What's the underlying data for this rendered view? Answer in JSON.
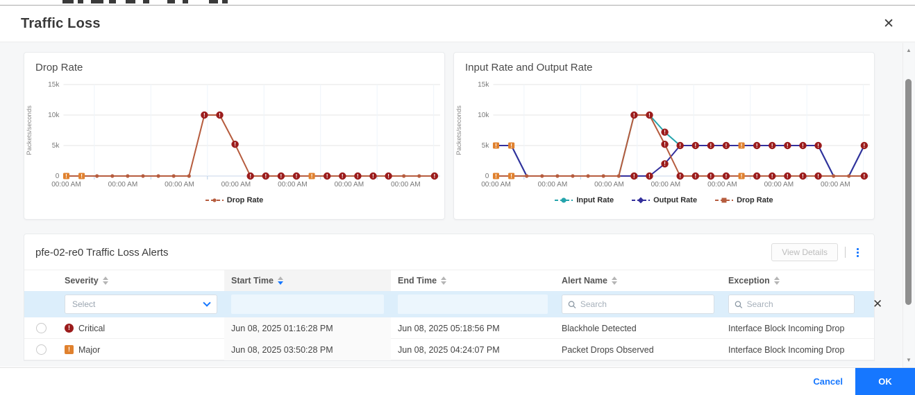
{
  "modal": {
    "title": "Traffic Loss",
    "close_icon": "✕"
  },
  "footer": {
    "cancel_label": "Cancel",
    "ok_label": "OK"
  },
  "colors": {
    "accent": "#1677ff",
    "critical": "#9b1c1c",
    "major": "#e0812e",
    "input_rate": "#25a4ac",
    "output_rate": "#332f9c",
    "drop_rate": "#b65c3e"
  },
  "chart_data": [
    {
      "type": "line",
      "title": "Drop Rate",
      "ylabel": "Packets/seconds",
      "ylim": [
        0,
        15000
      ],
      "yticks": [
        0,
        5000,
        10000,
        15000
      ],
      "ytick_labels": [
        "0",
        "5k",
        "10k",
        "15k"
      ],
      "xtick_labels": [
        "00:00 AM",
        "00:00 AM",
        "00:00 AM",
        "00:00 AM",
        "00:00 AM",
        "00:00 AM",
        "00:00 AM"
      ],
      "grid": true,
      "legend_position": "bottom",
      "series": [
        {
          "name": "Drop Rate",
          "color": "#b65c3e",
          "values": [
            0,
            0,
            0,
            0,
            0,
            0,
            0,
            0,
            0,
            10000,
            10000,
            5200,
            0,
            0,
            0,
            0,
            0,
            0,
            0,
            0,
            0,
            0,
            0,
            0,
            0
          ],
          "markers": [
            "major",
            "major",
            "dot",
            "dot",
            "dot",
            "dot",
            "dot",
            "dot",
            "dot",
            "critical",
            "critical",
            "critical",
            "critical",
            "critical",
            "critical",
            "critical",
            "major",
            "critical",
            "critical",
            "critical",
            "critical",
            "critical",
            "dot",
            "dot",
            "critical"
          ]
        }
      ],
      "legend": [
        {
          "label": "Drop Rate",
          "color": "#b65c3e",
          "marker": "dot"
        }
      ]
    },
    {
      "type": "line",
      "title": "Input Rate and Output Rate",
      "ylabel": "Packets/seconds",
      "ylim": [
        0,
        15000
      ],
      "yticks": [
        0,
        5000,
        10000,
        15000
      ],
      "ytick_labels": [
        "0",
        "5k",
        "10k",
        "15k"
      ],
      "xtick_labels": [
        "00:00 AM",
        "00:00 AM",
        "00:00 AM",
        "00:00 AM",
        "00:00 AM",
        "00:00 AM",
        "00:00 AM"
      ],
      "grid": true,
      "legend_position": "bottom",
      "series": [
        {
          "name": "Input Rate",
          "color": "#25a4ac",
          "values": [
            5000,
            5000,
            0,
            0,
            0,
            0,
            0,
            0,
            0,
            10000,
            10000,
            7200,
            5000,
            5000,
            5000,
            5000,
            5000,
            5000,
            5000,
            5000,
            5000,
            5000,
            0,
            0,
            5000
          ],
          "markers": [
            "none",
            "none",
            "none",
            "none",
            "none",
            "none",
            "none",
            "none",
            "none",
            "none",
            "none",
            "critical",
            "none",
            "none",
            "none",
            "none",
            "none",
            "none",
            "none",
            "none",
            "none",
            "none",
            "none",
            "none",
            "none"
          ]
        },
        {
          "name": "Output Rate",
          "color": "#332f9c",
          "values": [
            5000,
            5000,
            0,
            0,
            0,
            0,
            0,
            0,
            0,
            0,
            0,
            2000,
            5000,
            5000,
            5000,
            5000,
            5000,
            5000,
            5000,
            5000,
            5000,
            5000,
            0,
            0,
            5000
          ],
          "markers": [
            "major",
            "major",
            "none",
            "none",
            "none",
            "none",
            "none",
            "none",
            "none",
            "critical",
            "critical",
            "critical",
            "critical",
            "critical",
            "critical",
            "critical",
            "major",
            "critical",
            "critical",
            "critical",
            "critical",
            "critical",
            "none",
            "none",
            "critical"
          ]
        },
        {
          "name": "Drop Rate",
          "color": "#b65c3e",
          "values": [
            0,
            0,
            0,
            0,
            0,
            0,
            0,
            0,
            0,
            10000,
            10000,
            5200,
            0,
            0,
            0,
            0,
            0,
            0,
            0,
            0,
            0,
            0,
            0,
            0,
            0
          ],
          "markers": [
            "major",
            "major",
            "dot",
            "dot",
            "dot",
            "dot",
            "dot",
            "dot",
            "dot",
            "critical",
            "critical",
            "critical",
            "critical",
            "critical",
            "critical",
            "critical",
            "major",
            "critical",
            "critical",
            "critical",
            "critical",
            "critical",
            "dot",
            "dot",
            "critical"
          ]
        }
      ],
      "legend": [
        {
          "label": "Input Rate",
          "color": "#25a4ac",
          "marker": "round"
        },
        {
          "label": "Output Rate",
          "color": "#332f9c",
          "marker": "diamond"
        },
        {
          "label": "Drop Rate",
          "color": "#b65c3e",
          "marker": "square"
        }
      ]
    }
  ],
  "alerts_table": {
    "title": "pfe-02-re0 Traffic Loss Alerts",
    "view_details_label": "View Details",
    "kebab_icon": "vertical-ellipsis",
    "columns": [
      {
        "label": "Severity",
        "sortable": true,
        "sorted": null
      },
      {
        "label": "Start Time",
        "sortable": true,
        "sorted": "desc"
      },
      {
        "label": "End Time",
        "sortable": true,
        "sorted": null
      },
      {
        "label": "Alert Name",
        "sortable": true,
        "sorted": null
      },
      {
        "label": "Exception",
        "sortable": true,
        "sorted": null
      }
    ],
    "filters": {
      "severity_placeholder": "Select",
      "alert_name_placeholder": "Search",
      "exception_placeholder": "Search"
    },
    "rows": [
      {
        "severity": "Critical",
        "severity_level": "critical",
        "start_time": "Jun 08, 2025 01:16:28 PM",
        "end_time": "Jun 08, 2025 05:18:56 PM",
        "alert_name": "Blackhole Detected",
        "exception": "Interface Block Incoming Drop"
      },
      {
        "severity": "Major",
        "severity_level": "major",
        "start_time": "Jun 08, 2025 03:50:28 PM",
        "end_time": "Jun 08, 2025 04:24:07 PM",
        "alert_name": "Packet Drops Observed",
        "exception": "Interface Block Incoming Drop"
      }
    ]
  }
}
